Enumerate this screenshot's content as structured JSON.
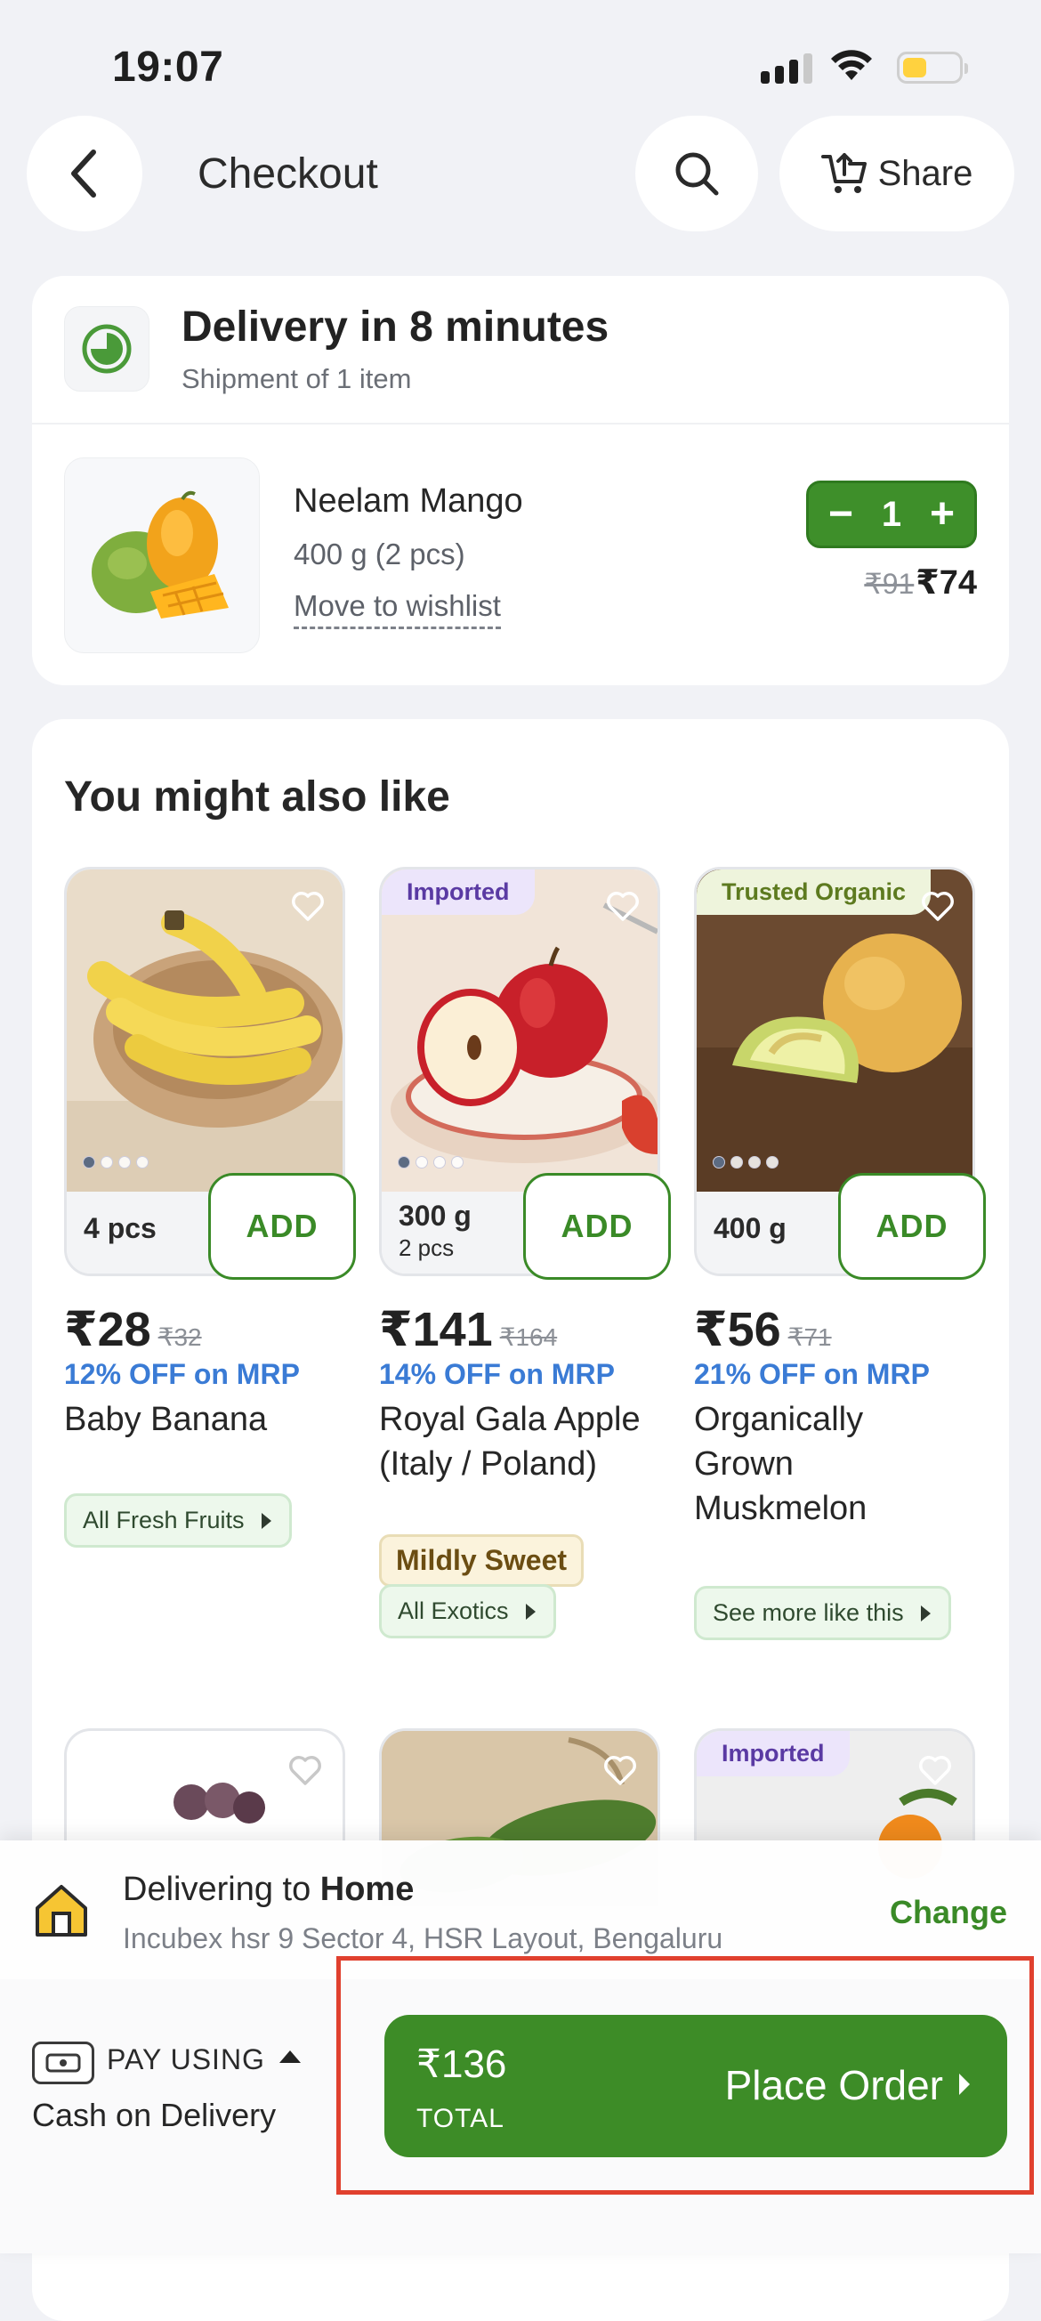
{
  "status_bar": {
    "time": "19:07"
  },
  "header": {
    "title": "Checkout",
    "share_label": "Share"
  },
  "delivery": {
    "title": "Delivery in 8 minutes",
    "subtitle": "Shipment of 1 item",
    "item": {
      "name": "Neelam Mango",
      "weight": "400 g (2 pcs)",
      "wishlist_label": "Move to wishlist",
      "quantity": "1",
      "mrp": "₹91",
      "price": "₹74"
    }
  },
  "suggestions": {
    "title": "You might also like",
    "products": [
      {
        "badge": "",
        "qty": "4 pcs",
        "qty_sub": "",
        "add_label": "ADD",
        "price": "₹28",
        "mrp": "₹32",
        "offer": "12% OFF on MRP",
        "name": "Baby Banana",
        "tag": "",
        "chip": "All Fresh Fruits"
      },
      {
        "badge": "Imported",
        "qty": "300 g",
        "qty_sub": "2 pcs",
        "add_label": "ADD",
        "price": "₹141",
        "mrp": "₹164",
        "offer": "14% OFF on MRP",
        "name": "Royal Gala Apple (Italy / Poland)",
        "tag": "Mildly Sweet",
        "chip": "All Exotics"
      },
      {
        "badge": "Trusted Organic",
        "qty": "400 g",
        "qty_sub": "",
        "add_label": "ADD",
        "price": "₹56",
        "mrp": "₹71",
        "offer": "21% OFF on MRP",
        "name": "Organically Grown Muskmelon",
        "tag": "",
        "chip": "See more like this"
      }
    ],
    "second_row_badge": "Imported"
  },
  "bottom_sheet": {
    "address_prefix": "Delivering to",
    "address_name": "Home",
    "address_line": "Incubex hsr 9 Sector 4, HSR Layout, Bengaluru",
    "change_label": "Change",
    "pay_label": "PAY USING",
    "pay_method": "Cash on Delivery",
    "total_amount": "₹136",
    "total_label": "TOTAL",
    "place_order_label": "Place Order"
  },
  "colors": {
    "brand_green": "#3d8c27",
    "offer_blue": "#3a7bd5",
    "highlight_red": "#e0402e"
  }
}
